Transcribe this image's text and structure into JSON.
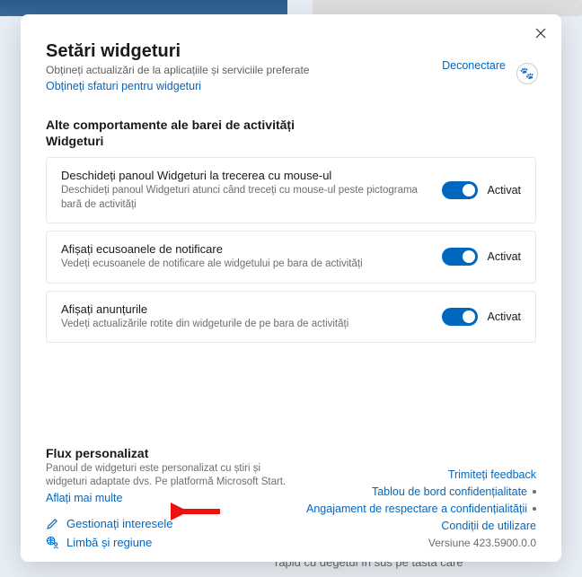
{
  "bg": {
    "bottom_text": "rapid cu degetul în sus pe tasta care"
  },
  "header": {
    "title": "Setări widgeturi",
    "subtitle": "Obțineți actualizări de la aplicațiile și serviciile preferate",
    "tips_link": "Obțineți sfaturi pentru widgeturi",
    "signout": "Deconectare"
  },
  "behaviors": {
    "heading": "Alte comportamente ale barei de activități",
    "subhead": "Widgeturi",
    "items": [
      {
        "title": "Deschideți panoul Widgeturi la trecerea cu mouse-ul",
        "desc": "Deschideți panoul Widgeturi atunci când treceți cu mouse-ul peste pictograma bară de activități",
        "state_label": "Activat"
      },
      {
        "title": "Afișați ecusoanele de notificare",
        "desc": "Vedeți ecusoanele de notificare ale widgetului pe bara de activități",
        "state_label": "Activat"
      },
      {
        "title": "Afișați anunțurile",
        "desc": "Vedeți actualizările rotite din widgeturile de pe bara de activități",
        "state_label": "Activat"
      }
    ]
  },
  "footer": {
    "heading": "Flux personalizat",
    "desc": "Panoul de widgeturi este personalizat cu știri și widgeturi adaptate dvs. Pe platformă Microsoft Start.",
    "learn_more": "Aflați mai multe",
    "manage_interests": "Gestionați interesele",
    "lang_region": "Limbă și regiune",
    "right_links": {
      "feedback": "Trimiteți feedback",
      "privacy_dash": "Tablou de bord confidențialitate",
      "privacy_commit": "Angajament de respectare a confidențialității",
      "terms": "Condiții de utilizare"
    },
    "version": "Versiune 423.5900.0.0"
  }
}
